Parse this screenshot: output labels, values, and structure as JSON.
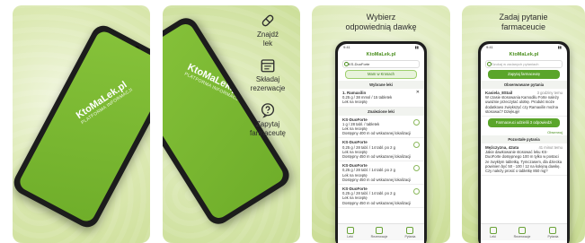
{
  "panel1": {
    "logo_main": "KtoMaLek.pl",
    "logo_sub": "PLATFORMA INFORMACJI"
  },
  "panel2": {
    "logo_main": "KtoMaLek.pl",
    "logo_sub": "PLATFORMA INFORMACJI",
    "features": [
      {
        "icon": "pill-icon",
        "label_1": "Znajdź",
        "label_2": "lek"
      },
      {
        "icon": "calendar-icon",
        "label_1": "Składaj",
        "label_2": "rezerwacje"
      },
      {
        "icon": "question-icon",
        "label_1": "Zapytaj",
        "label_2": "farmaceutę"
      }
    ]
  },
  "panel3": {
    "heading_1": "Wybierz",
    "heading_2": "odpowiednią dawkę",
    "status_time": "9:41",
    "brand": "KtoMaLek.pl",
    "search_value": "KS-DuoForte",
    "map_button": "Mam w Krosach",
    "section_selected": "Wybrane leki",
    "selected_item": {
      "title": "1. Ramaxilin",
      "l1": "0,25 g / 38 mmol / 15 tabletek",
      "l2": "Lek na receptę"
    },
    "section_found": "Znalezione leki",
    "found": [
      {
        "title": "KS-DuoForte",
        "l1": "1 g / 28 tabl. / tabletek",
        "l2": "Lek na receptę",
        "l3": "Dostępny 400 m od wskazanej lokalizacji"
      },
      {
        "title": "KS-DuoForte",
        "l1": "0,25 g / 28 tabl. / 14 tabl. po 2 g",
        "l2": "Lek na receptę",
        "l3": "Dostępny 450 m od wskazanej lokalizacji"
      },
      {
        "title": "KS-DuoForte",
        "l1": "0,25 g / 28 tabl. / 14 tabl. po 2 g",
        "l2": "Lek na receptę",
        "l3": "Dostępny 450 m od wskazanej lokalizacji"
      },
      {
        "title": "KS-DuoForte",
        "l1": "0,25 g / 28 tabl. / 14 tabl. po 2 g",
        "l2": "Lek na receptę",
        "l3": "Dostępny 450 m od wskazanej lokalizacji"
      }
    ],
    "tabs": [
      "Leki",
      "Rezerwacje",
      "Pytania"
    ]
  },
  "panel4": {
    "heading_1": "Zadaj pytanie",
    "heading_2": "farmaceucie",
    "status_time": "9:41",
    "brand": "KtoMaLek.pl",
    "search_placeholder": "Szukaj w zadanych pytaniach",
    "ask_button": "Zapytaj farmaceutę",
    "section_watched": "Obserwowane pytania",
    "q1_user": "Kasiela_8Stail",
    "q1_time": "3 godziny temu",
    "q1_text": "W czasie stosowania Kamodilu Forte należy uważnie przeczytać ulotkę. Produkt może dodatkowo zwiększyć czy Ramaxilin można stosować? Dziękuję!",
    "answers_button": "Farmaceuci udzielili 3 odpowiedzi",
    "watch_link": "Obserwuj",
    "section_recent": "Pozostałe pytania",
    "q2_user": "Mężczyzna, 42ata",
    "q2_time": "41 minut temu",
    "q2_text": "Jakie dawkowanie stosować leku KS-DuoForte dostępnego 100 m tylko w postaci ze zwykłym tabletką. Tymczasem, dla dziecka powinien być 50 - 100 / 12 na kolejną dawkę. Czy należy prosić o tabletkę 850 mg?",
    "tabs": [
      "Leki",
      "Rezerwacje",
      "Pytania"
    ]
  },
  "colors": {
    "brand_green": "#5aa52a",
    "phone_screen_green": "#7bb932"
  }
}
